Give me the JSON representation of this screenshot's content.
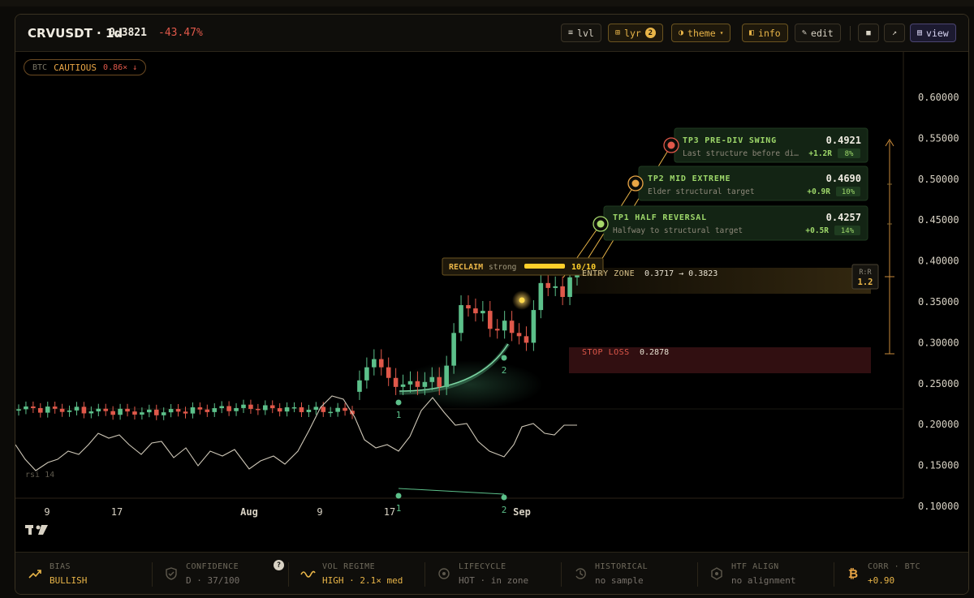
{
  "header": {
    "ticker": "CRVUSDT · 1d",
    "price": "0.3821",
    "change": "-43.47%",
    "buttons": {
      "lvl": "lvl",
      "lyr": "lyr",
      "lyr_badge": "2",
      "theme": "theme",
      "info": "info",
      "edit": "edit",
      "view": "view"
    }
  },
  "btc_pill": {
    "label": "BTC",
    "state": "CAUTIOUS",
    "mult": "0.86× ↓"
  },
  "price_axis": [
    "0.60000",
    "0.55000",
    "0.50000",
    "0.45000",
    "0.40000",
    "0.35000",
    "0.30000",
    "0.25000",
    "0.20000",
    "0.15000",
    "0.10000"
  ],
  "time_axis": [
    "9",
    "17",
    "Aug",
    "9",
    "17",
    "Sep"
  ],
  "targets": [
    {
      "name": "TP3 PRE-DIV SWING",
      "price": "0.4921",
      "desc": "Last structure before di…",
      "r": "+1.2R",
      "pct": "8%",
      "color": "#e0584a"
    },
    {
      "name": "TP2 MID EXTREME",
      "price": "0.4690",
      "desc": "Elder structural target",
      "r": "+0.9R",
      "pct": "10%",
      "color": "#e9a545"
    },
    {
      "name": "TP1 HALF REVERSAL",
      "price": "0.4257",
      "desc": "Halfway to structural target",
      "r": "+0.5R",
      "pct": "14%",
      "color": "#a6d86a"
    }
  ],
  "reclaim": {
    "label": "RECLAIM",
    "strength": "strong",
    "score": "10/10"
  },
  "entry": {
    "label": "ENTRY ZONE",
    "range": "0.3717 → 0.3823"
  },
  "stop": {
    "label": "STOP LOSS",
    "price": "0.2878"
  },
  "rr": {
    "label": "R:R",
    "value": "1.2"
  },
  "rsi": {
    "label": "rsi 14"
  },
  "divergence_points": [
    "1",
    "2"
  ],
  "footer": [
    {
      "label": "BIAS",
      "value": "BULLISH",
      "icon": "trend-up-icon",
      "active": true
    },
    {
      "label": "CONFIDENCE",
      "value": "D · 37/100",
      "icon": "shield-icon",
      "active": false,
      "help": "?"
    },
    {
      "label": "VOL REGIME",
      "value": "HIGH · 2.1× med",
      "icon": "wave-icon",
      "active": true
    },
    {
      "label": "LIFECYCLE",
      "value": "HOT · in zone",
      "icon": "target-icon",
      "active": false
    },
    {
      "label": "HISTORICAL",
      "value": "no sample",
      "icon": "history-icon",
      "active": false
    },
    {
      "label": "HTF ALIGN",
      "value": "no alignment",
      "icon": "hexagon-icon",
      "active": false
    },
    {
      "label": "CORR · BTC",
      "value": "+0.90",
      "icon": "bitcoin-icon",
      "active": true
    }
  ],
  "colors": {
    "up": "#5cc08a",
    "down": "#e0584a",
    "accent": "#e9b548",
    "panel": "#0f0e0b"
  }
}
